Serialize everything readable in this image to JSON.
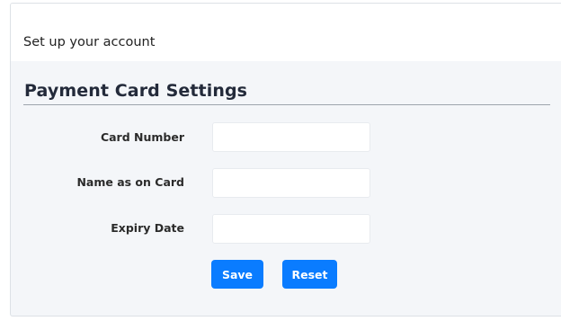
{
  "header": {
    "title": "Set up your account"
  },
  "section": {
    "title": "Payment Card Settings"
  },
  "form": {
    "card_number": {
      "label": "Card Number",
      "value": "",
      "placeholder": ""
    },
    "name_on_card": {
      "label": "Name as on Card",
      "value": "",
      "placeholder": ""
    },
    "expiry_date": {
      "label": "Expiry Date",
      "value": "",
      "placeholder": ""
    }
  },
  "buttons": {
    "save_label": "Save",
    "reset_label": "Reset"
  },
  "colors": {
    "accent": "#0a7cff",
    "panel_background": "#f4f6f9"
  }
}
